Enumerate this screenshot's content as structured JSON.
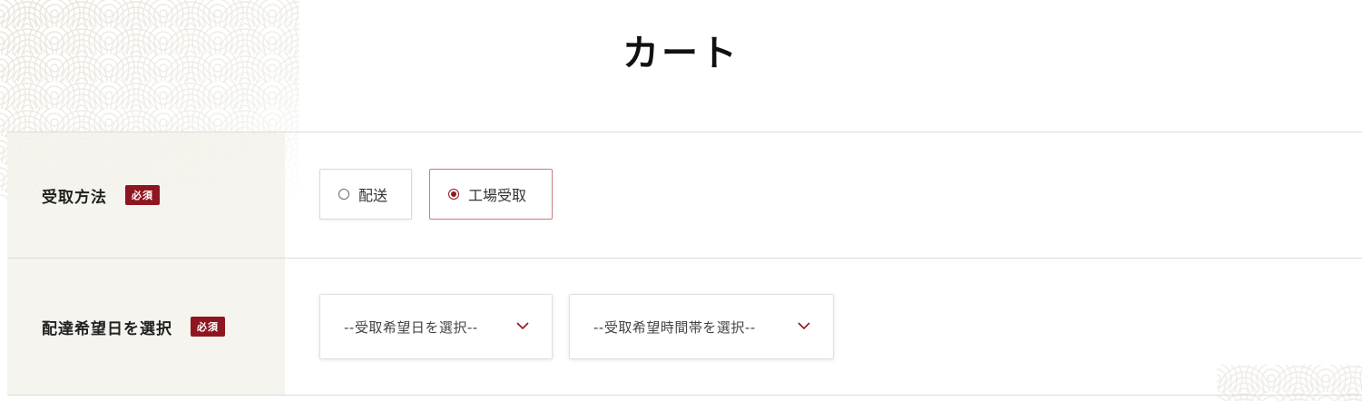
{
  "page": {
    "title": "カート"
  },
  "form": {
    "receive_method": {
      "label": "受取方法",
      "required": "必須",
      "options": [
        {
          "label": "配送",
          "selected": false
        },
        {
          "label": "工場受取",
          "selected": true
        }
      ]
    },
    "delivery_date": {
      "label": "配達希望日を選択",
      "required": "必須",
      "date_select": {
        "value": "--受取希望日を選択--"
      },
      "time_select": {
        "value": "--受取希望時間帯を選択--"
      }
    }
  },
  "colors": {
    "accent": "#8f1620",
    "label_bg": "#f4f2ec",
    "border": "#dcdcdc",
    "wave_pattern": "#e8e4da"
  },
  "icons": {
    "select_arrow": "chevron-down-icon",
    "background": "seigaiha-wave-pattern"
  }
}
